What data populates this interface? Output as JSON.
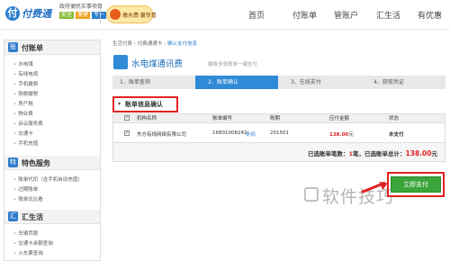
{
  "header": {
    "logo_mark": "付",
    "logo_text": "付费通",
    "slogan": "政府便民实事项目",
    "slogan_tags": [
      "安全",
      "便捷",
      "专一"
    ],
    "promo_text": "缴水费·赢惊喜",
    "nav": [
      "首页",
      "付账单",
      "管账户",
      "汇生活",
      "有优惠"
    ]
  },
  "sidebar": {
    "sections": [
      {
        "icon": "账",
        "title": "付账单",
        "items": [
          "水电煤",
          "有线电视",
          "手机缴费",
          "购税缴税",
          "房产税",
          "物业费",
          "诉讼服务费",
          "交通卡",
          "手机充值"
        ]
      },
      {
        "icon": "特",
        "title": "特色服务",
        "items": [
          "账单代扣（含手机自动充值）",
          "过期账单",
          "账单比比看"
        ]
      },
      {
        "icon": "汇",
        "title": "汇生活",
        "items": [
          "车辆罚款",
          "交通卡余额查询",
          "火车票查询"
        ]
      }
    ]
  },
  "breadcrumb": {
    "items": [
      "生活付费",
      "付费通通卡",
      "确认支付信息"
    ]
  },
  "page": {
    "title": "水电煤通讯费",
    "subtitle": "缴费多张账单一键支付"
  },
  "steps": [
    "1、账单查询",
    "2、账单确认",
    "3、在线支付",
    "4、获取凭证"
  ],
  "section_title": "账单信息确认",
  "table": {
    "headers": [
      "机构名称",
      "账单编号",
      "账期",
      "应付金额",
      "状态"
    ],
    "rows": [
      {
        "org": "东方有线网络有限公司",
        "bill_no": "16801008242",
        "barcode_link": "条码",
        "period": "201501",
        "amount": "138.00",
        "amount_unit": "元",
        "status": "未支付"
      }
    ]
  },
  "summary": {
    "prefix": "已选账单笔数：",
    "count": "1",
    "mid": "笔，已选账单总计：",
    "total": "138.00",
    "unit": "元"
  },
  "pay_button": "立即支付",
  "watermark": "软件技巧",
  "colors": {
    "brand": "#2f8ad8",
    "pay": "#3aa53a",
    "highlight": "#e02222"
  }
}
